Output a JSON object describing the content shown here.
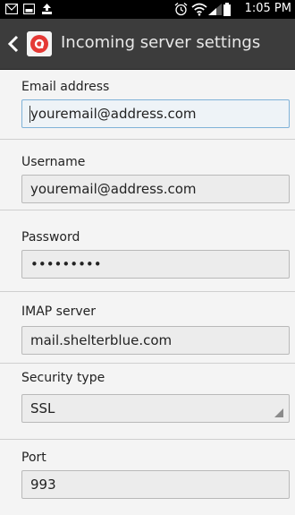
{
  "status_bar": {
    "time": "1:05 PM",
    "left_icons": [
      "mail-icon",
      "image-icon",
      "upload-icon"
    ],
    "right_icons": [
      "alarm-icon",
      "wifi-icon",
      "signal-icon",
      "battery-icon"
    ]
  },
  "header": {
    "title": "Incoming server settings",
    "app_icon": "mail-app-icon"
  },
  "form": {
    "email": {
      "label": "Email address",
      "value": "youremail@address.com"
    },
    "username": {
      "label": "Username",
      "value": "youremail@address.com"
    },
    "password": {
      "label": "Password",
      "value": "•••••••••"
    },
    "imap": {
      "label": "IMAP server",
      "value": "mail.shelterblue.com"
    },
    "security": {
      "label": "Security type",
      "value": "SSL"
    },
    "port": {
      "label": "Port",
      "value": "993"
    }
  },
  "colors": {
    "status_bar": "#000000",
    "action_bar": "#3c3c3c",
    "background": "#f4f4f4",
    "focus_border": "#7fb2d8",
    "app_icon_accent": "#e53935"
  }
}
